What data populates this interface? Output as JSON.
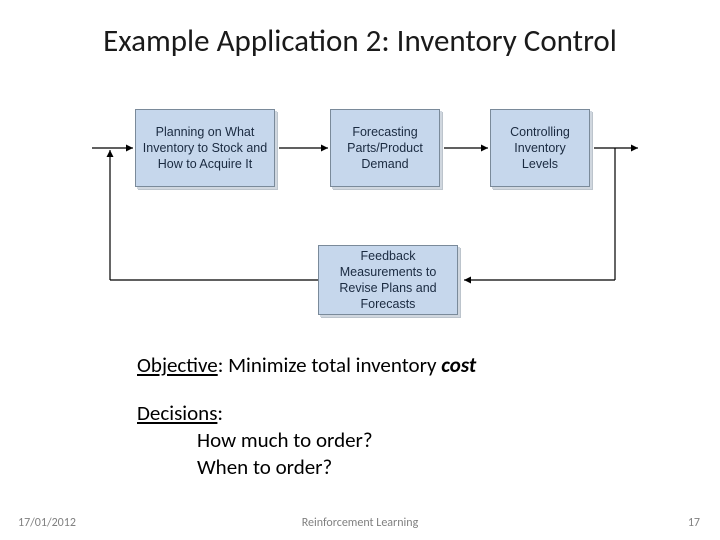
{
  "title": "Example Application 2: Inventory Control",
  "diagram": {
    "box1": "Planning on What Inventory to Stock and How to Acquire It",
    "box2": "Forecasting Parts/Product Demand",
    "box3": "Controlling Inventory Levels",
    "box4": "Feedback Measurements to Revise Plans and Forecasts"
  },
  "text": {
    "objective_label": "Objective",
    "objective_body": ":  Minimize total inventory ",
    "objective_cost": "cost",
    "decisions_label": "Decisions",
    "decisions_colon": ":",
    "decision1": "How much to order?",
    "decision2": "When to order?"
  },
  "footer": {
    "date": "17/01/2012",
    "center": "Reinforcement Learning",
    "page": "17"
  }
}
